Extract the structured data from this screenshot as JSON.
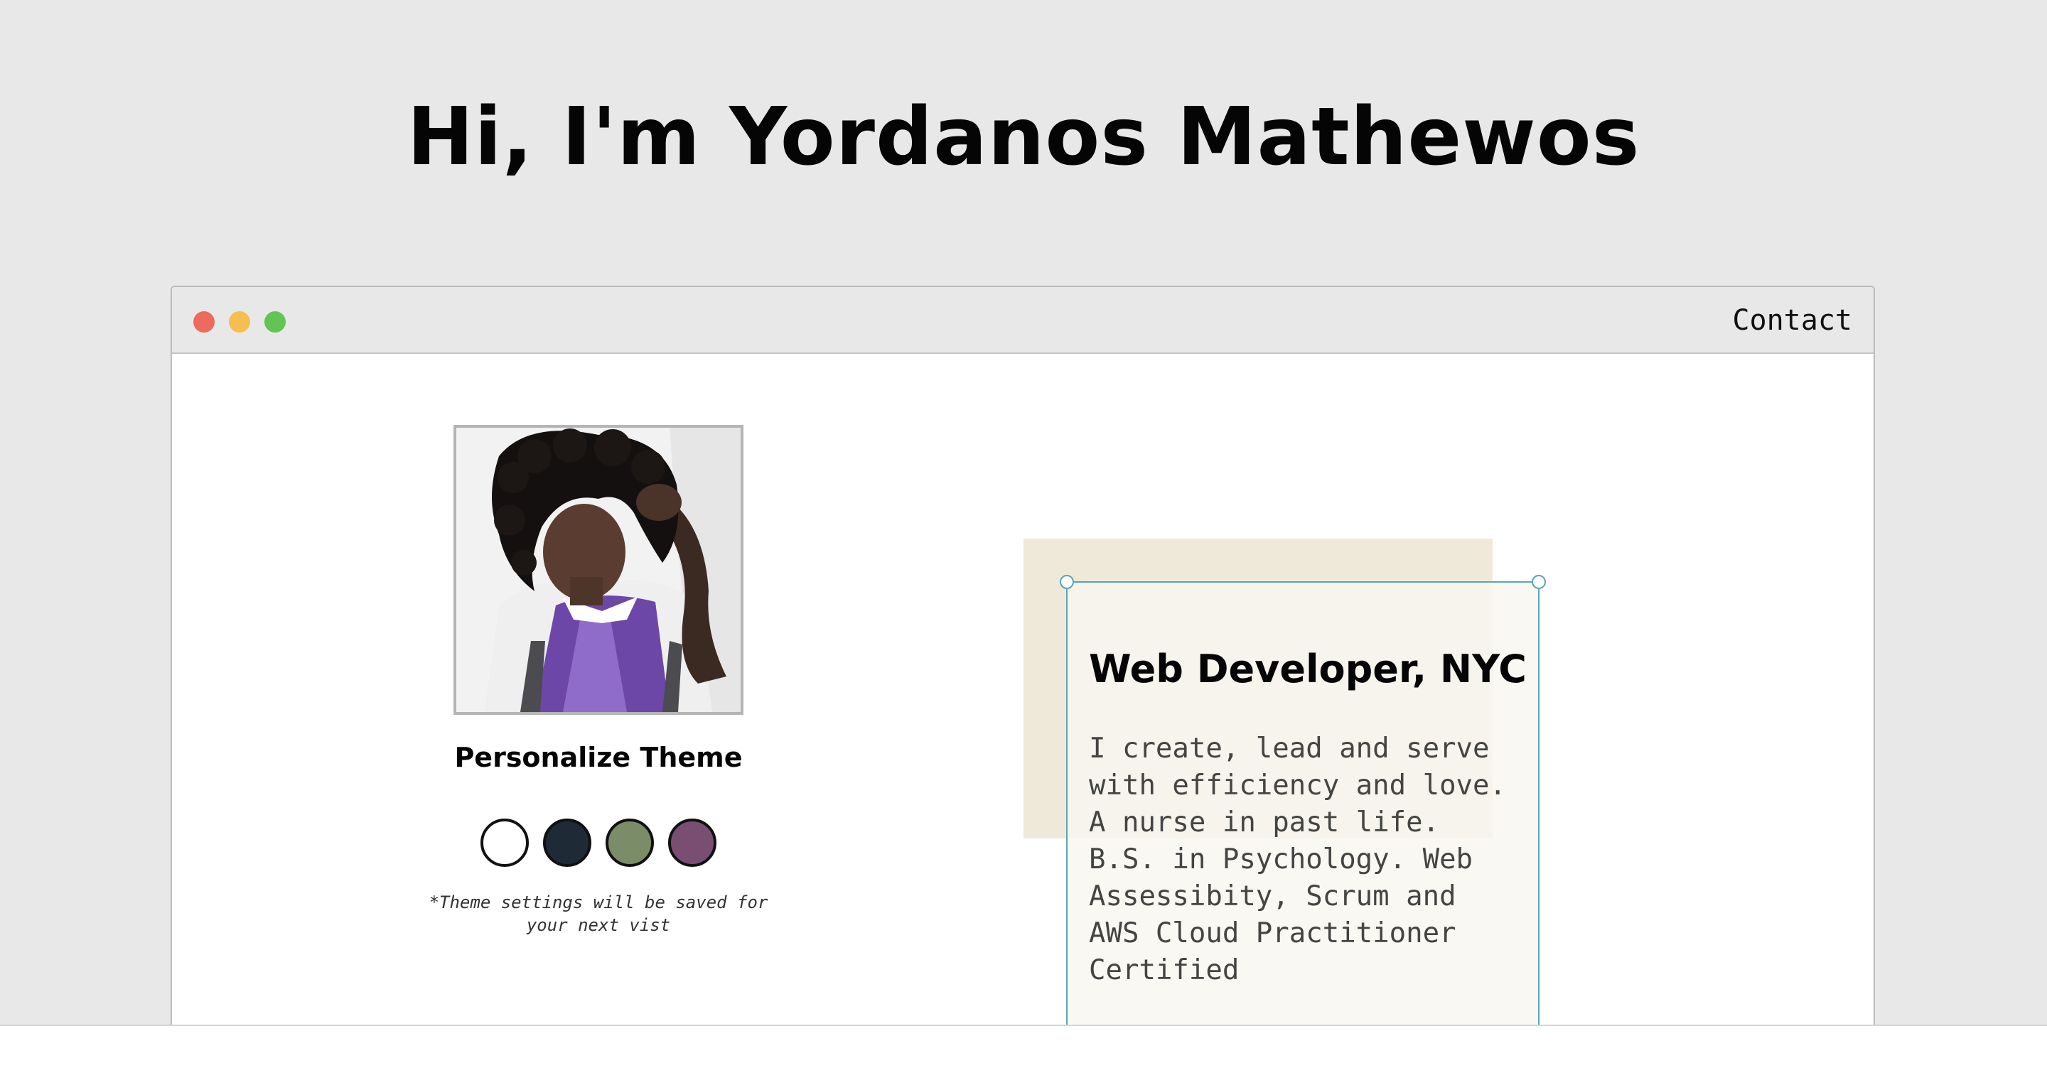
{
  "header": {
    "title": "Hi, I'm Yordanos Mathewos"
  },
  "window": {
    "controls": [
      "close",
      "minimize",
      "maximize"
    ],
    "control_colors": [
      "#ed6a5e",
      "#f5bf4f",
      "#61c554"
    ],
    "nav": {
      "contact_label": "Contact"
    }
  },
  "profile": {
    "photo_icon": "profile-photo"
  },
  "theme": {
    "title": "Personalize Theme",
    "swatches": [
      {
        "name": "white",
        "color": "#ffffff"
      },
      {
        "name": "navy",
        "color": "#1e2a36"
      },
      {
        "name": "sage",
        "color": "#7b8c69"
      },
      {
        "name": "plum",
        "color": "#7a4d73"
      }
    ],
    "note": "*Theme settings will be saved for your next vist"
  },
  "intro_card": {
    "title": "Web Developer, NYC",
    "body": "I create, lead and serve with efficiency and love. A nurse in past life. B.S. in Psychology. Web Assessibity, Scrum and AWS Cloud Practitioner Certified"
  }
}
